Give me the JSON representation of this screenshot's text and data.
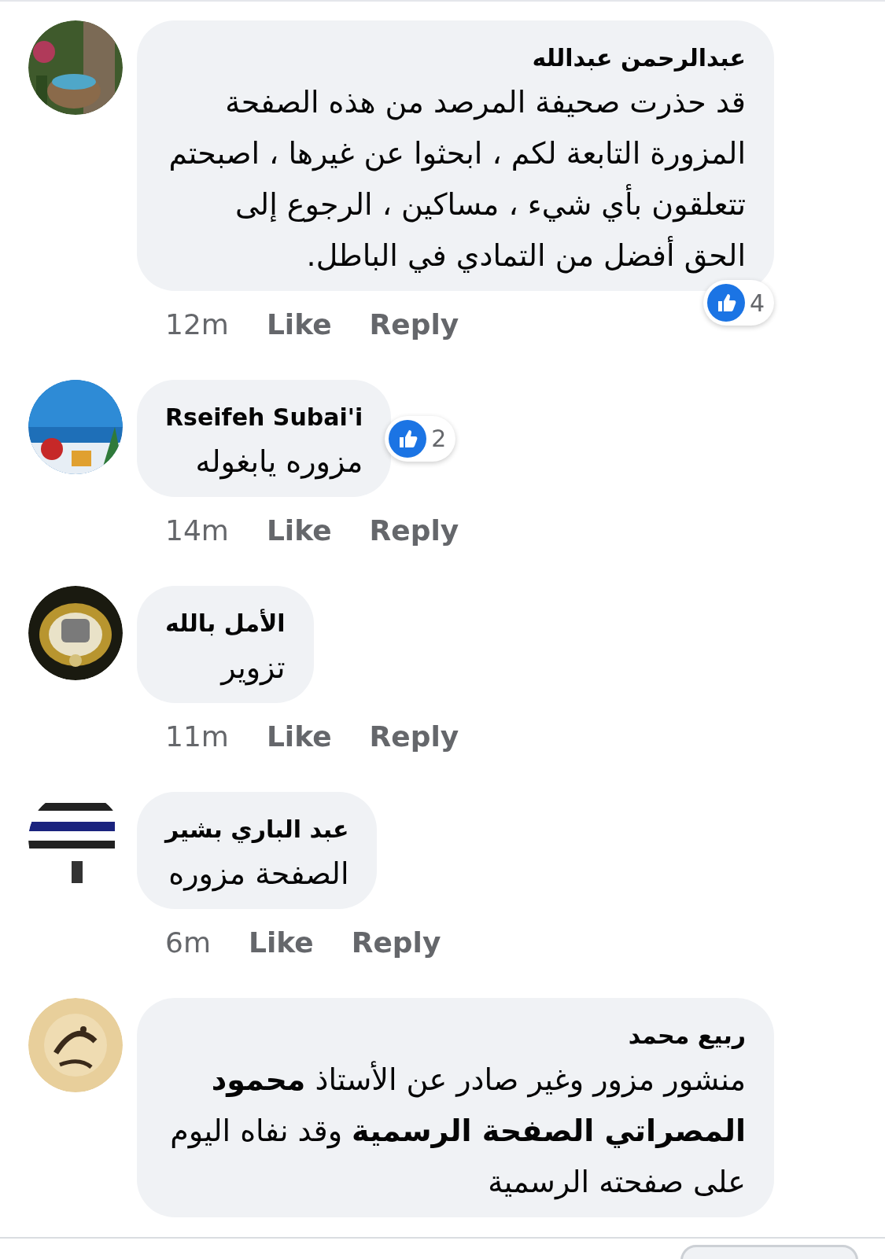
{
  "comments": [
    {
      "author": "عبدالرحمن عبدالله",
      "body": "قد حذرت صحيفة المرصد من هذه الصفحة المزورة التابعة لكم ، ابحثوا عن غيرها ، اصبحتم تتعلقون بأي شيء ، مساكين ، الرجوع إلى الحق أفضل من التمادي في الباطل.",
      "reactions": "4",
      "time": "12m",
      "like": "Like",
      "reply": "Reply"
    },
    {
      "author": "Rseifeh Subai'i",
      "body": "مزوره يابغوله",
      "reactions": "2",
      "time": "14m",
      "like": "Like",
      "reply": "Reply"
    },
    {
      "author": "الأمل بالله",
      "body": "تزوير",
      "time": "11m",
      "like": "Like",
      "reply": "Reply"
    },
    {
      "author": "عبد الباري بشير",
      "body": "الصفحة مزوره",
      "time": "6m",
      "like": "Like",
      "reply": "Reply"
    },
    {
      "author": "ربيع محمد",
      "body": "منشور مزور وغير صادر عن الأستاذ **محمود المصراتي الصفحة الرسمية** وقد نفاه اليوم على صفحته الرسمية"
    }
  ]
}
